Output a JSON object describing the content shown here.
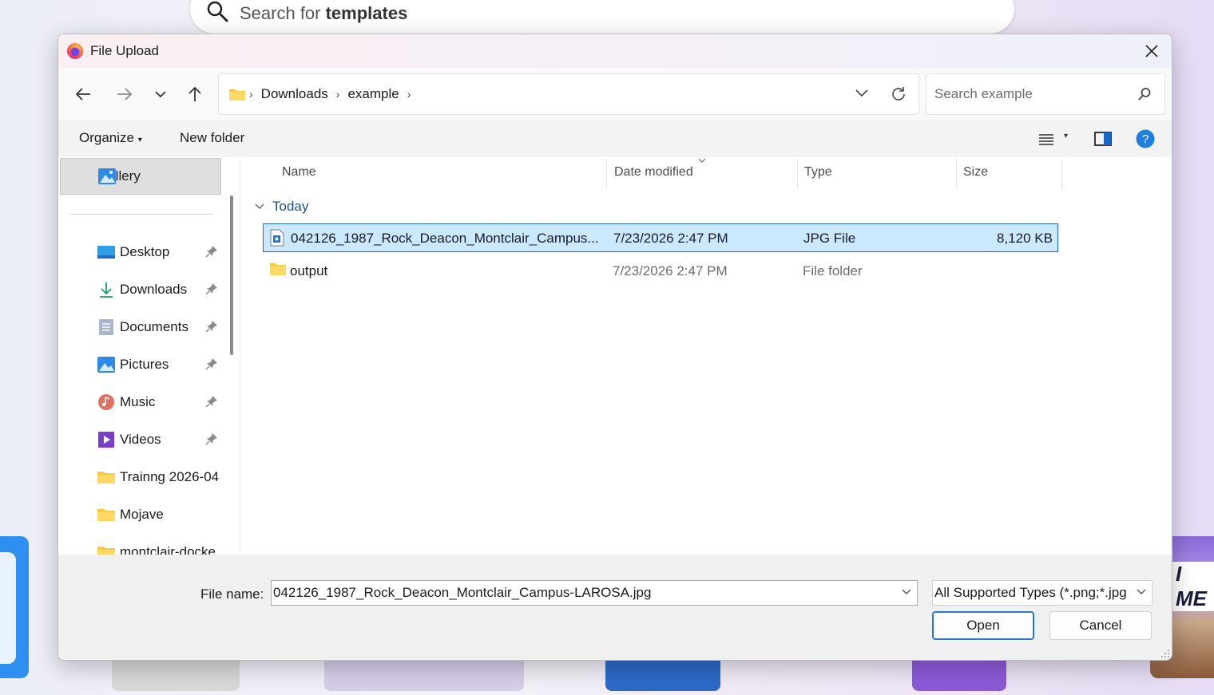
{
  "background": {
    "search_placeholder_prefix": "Search for ",
    "search_placeholder_bold": "templates",
    "card_text": "I ME"
  },
  "dialog": {
    "title": "File Upload",
    "nav": {
      "breadcrumbs": [
        "Downloads",
        "example"
      ],
      "search_placeholder": "Search example"
    },
    "toolbar": {
      "organize_label": "Organize",
      "new_folder_label": "New folder"
    },
    "sidebar": {
      "gallery_label": "Gallery",
      "items": [
        {
          "label": "Desktop",
          "icon": "desktop-icon",
          "pinned": true
        },
        {
          "label": "Downloads",
          "icon": "download-icon",
          "pinned": true
        },
        {
          "label": "Documents",
          "icon": "documents-icon",
          "pinned": true
        },
        {
          "label": "Pictures",
          "icon": "pictures-icon",
          "pinned": true
        },
        {
          "label": "Music",
          "icon": "music-icon",
          "pinned": true
        },
        {
          "label": "Videos",
          "icon": "videos-icon",
          "pinned": true
        },
        {
          "label": "Trainng 2026-04",
          "icon": "folder-icon",
          "pinned": false
        },
        {
          "label": "Mojave",
          "icon": "folder-icon",
          "pinned": false
        },
        {
          "label": "montclair-docke",
          "icon": "folder-icon",
          "pinned": false
        }
      ]
    },
    "columns": {
      "name": "Name",
      "date_modified": "Date modified",
      "type": "Type",
      "size": "Size"
    },
    "group_label": "Today",
    "files": [
      {
        "name": "042126_1987_Rock_Deacon_Montclair_Campus...",
        "date": "7/23/2026 2:47 PM",
        "type": "JPG File",
        "size": "8,120 KB",
        "selected": true
      },
      {
        "name": "output",
        "date": "7/23/2026 2:47 PM",
        "type": "File folder",
        "size": "",
        "selected": false
      }
    ],
    "footer": {
      "file_name_label": "File name:",
      "file_name_value": "042126_1987_Rock_Deacon_Montclair_Campus-LAROSA.jpg",
      "file_type_value": "All Supported Types (*.png;*.jpg",
      "open_label": "Open",
      "cancel_label": "Cancel"
    }
  },
  "colors": {
    "accent": "#0067c0",
    "selection_bg": "#cce8ff",
    "group_text": "#1e4f8f",
    "folder": "#f8c73f"
  }
}
